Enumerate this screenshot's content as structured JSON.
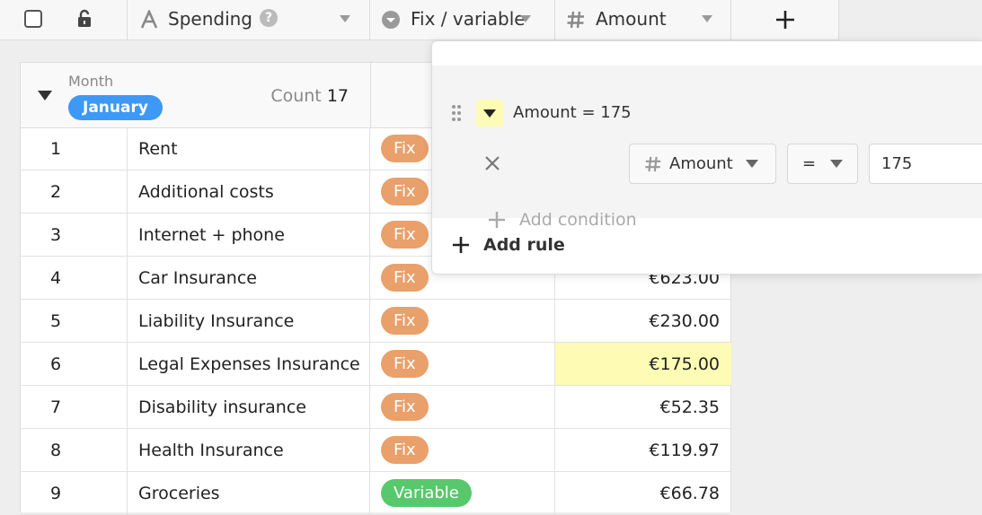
{
  "columns": [
    {
      "name": "Spending"
    },
    {
      "name": "Fix / variable"
    },
    {
      "name": "Amount"
    }
  ],
  "group": {
    "label": "Month",
    "value": "January",
    "count_label": "Count",
    "count": "17",
    "badge_color": "#3d99f5"
  },
  "rows": [
    {
      "num": "1",
      "spending": "Rent",
      "type": "Fix",
      "amount": ""
    },
    {
      "num": "2",
      "spending": "Additional costs",
      "type": "Fix",
      "amount": ""
    },
    {
      "num": "3",
      "spending": "Internet + phone",
      "type": "Fix",
      "amount": ""
    },
    {
      "num": "4",
      "spending": "Car Insurance",
      "type": "Fix",
      "amount": "€623.00"
    },
    {
      "num": "5",
      "spending": "Liability Insurance",
      "type": "Fix",
      "amount": "€230.00"
    },
    {
      "num": "6",
      "spending": "Legal Expenses Insurance",
      "type": "Fix",
      "amount": "€175.00",
      "highlight": true
    },
    {
      "num": "7",
      "spending": "Disability insurance",
      "type": "Fix",
      "amount": "€52.35"
    },
    {
      "num": "8",
      "spending": "Health Insurance",
      "type": "Fix",
      "amount": "€119.97"
    },
    {
      "num": "9",
      "spending": "Groceries",
      "type": "Variable",
      "amount": "€66.78"
    }
  ],
  "type_colors": {
    "Fix": "#e9a06b",
    "Variable": "#58c86c"
  },
  "highlight_color": "#fefbb5",
  "popup": {
    "rule_title": "Amount = 175",
    "condition": {
      "column": "Amount",
      "operator": "=",
      "value": "175"
    },
    "add_condition": "Add condition",
    "add_rule": "Add rule"
  },
  "icons": {
    "header_checkbox": "checkbox-icon",
    "lock": "lock-icon",
    "text_column": "text-column-icon",
    "single_select": "single-select-icon",
    "number_column": "hash-icon",
    "add_column": "plus-icon"
  }
}
